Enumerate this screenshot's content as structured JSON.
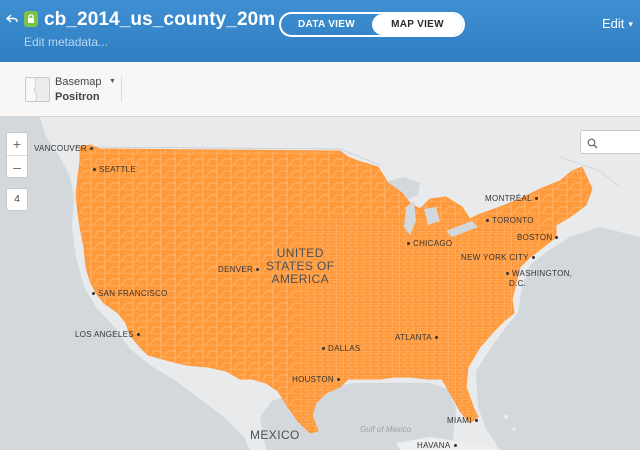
{
  "header": {
    "dataset_title": "cb_2014_us_county_20m",
    "edit_metadata": "Edit metadata...",
    "view_toggle": {
      "data_view": "DATA VIEW",
      "map_view": "MAP VIEW",
      "active": "map_view"
    },
    "edit_menu": "Edit",
    "colors": {
      "header_bg": "#3a8bd0",
      "lock_badge": "#7bc14a"
    }
  },
  "toolbar": {
    "basemap_label": "Basemap",
    "basemap_value": "Positron"
  },
  "map": {
    "zoom_in": "+",
    "zoom_out": "–",
    "zoom_level": "4",
    "search_placeholder": "",
    "country_label": "UNITED STATES OF AMERICA",
    "country_label_lines": [
      "UNITED",
      "STATES OF",
      "AMERICA"
    ],
    "mexico_label": "MEXICO",
    "water_label": "Gulf of Mexico",
    "fill_color": "#ff9a3c",
    "cities": {
      "vancouver": "VANCOUVER",
      "seattle": "SEATTLE",
      "montreal": "MONTRÉAL",
      "toronto": "TORONTO",
      "boston": "BOSTON",
      "chicago": "CHICAGO",
      "new_york": "NEW YORK CITY",
      "washington_1": "WASHINGTON,",
      "washington_2": "D.C.",
      "denver": "DENVER",
      "san_francisco": "SAN FRANCISCO",
      "los_angeles": "LOS ANGELES",
      "dallas": "DALLAS",
      "atlanta": "ATLANTA",
      "houston": "HOUSTON",
      "miami": "MIAMI",
      "havana": "HAVANA"
    }
  }
}
